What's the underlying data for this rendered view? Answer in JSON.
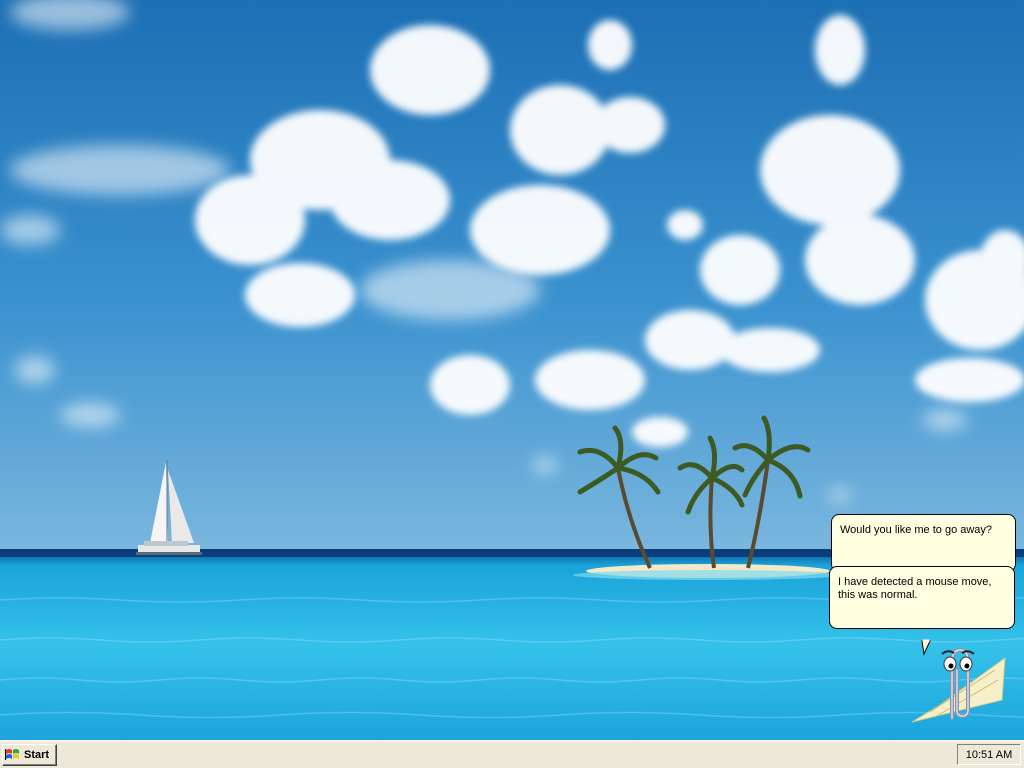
{
  "desktop": {
    "wallpaper": "tropical-island-wallpaper",
    "colors": {
      "sky": "#2e86c6",
      "sea": "#25b6e0",
      "sand": "#f3e9c9"
    }
  },
  "assistant": {
    "bubbles": [
      {
        "text": "Would you like me to go away?"
      },
      {
        "text": "I have detected a mouse move, this was normal."
      }
    ],
    "bubble_color": "#ffffe1",
    "character": "paperclip-assistant"
  },
  "taskbar": {
    "start_label": "Start",
    "start_icon": "windows-flag-icon",
    "clock": "10:51 AM",
    "color": "#ece9d8"
  }
}
